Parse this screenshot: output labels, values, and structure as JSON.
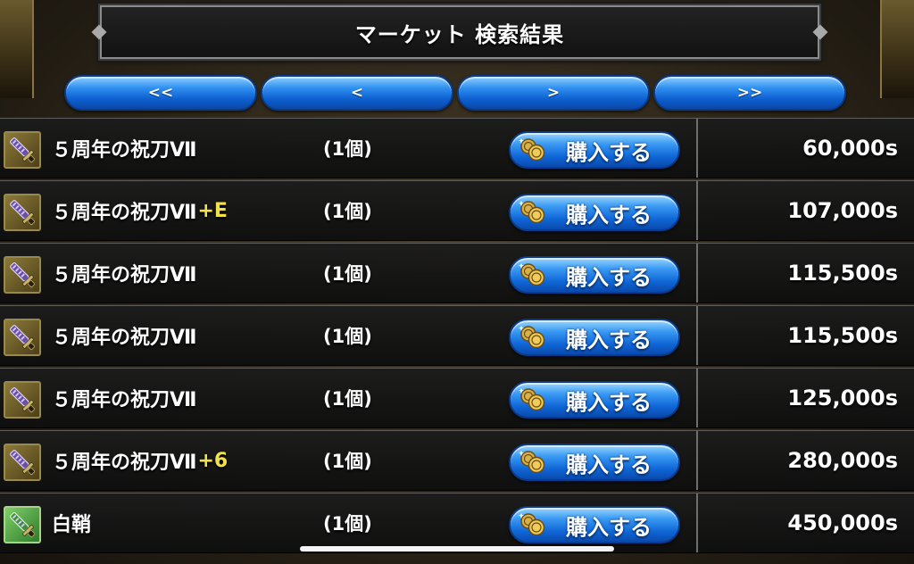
{
  "header": {
    "title": "マーケット 検索結果"
  },
  "nav": {
    "first": "<<",
    "prev": "<",
    "next": ">",
    "last": ">>"
  },
  "buy_label": "購入する",
  "colors": {
    "button_blue": "#0f66d6",
    "suffix_yellow": "#f2e24a",
    "text_white": "#ffffff"
  },
  "listings": [
    {
      "name": "５周年の祝刀Ⅶ",
      "suffix": "",
      "quantity": "(1個)",
      "price": "60,000s",
      "icon": "purple-sword-icon"
    },
    {
      "name": "５周年の祝刀Ⅶ",
      "suffix": "+E",
      "quantity": "(1個)",
      "price": "107,000s",
      "icon": "purple-sword-icon"
    },
    {
      "name": "５周年の祝刀Ⅶ",
      "suffix": "",
      "quantity": "(1個)",
      "price": "115,500s",
      "icon": "purple-sword-icon"
    },
    {
      "name": "５周年の祝刀Ⅶ",
      "suffix": "",
      "quantity": "(1個)",
      "price": "115,500s",
      "icon": "purple-sword-icon"
    },
    {
      "name": "５周年の祝刀Ⅶ",
      "suffix": "",
      "quantity": "(1個)",
      "price": "125,000s",
      "icon": "purple-sword-icon"
    },
    {
      "name": "５周年の祝刀Ⅶ",
      "suffix": "+6",
      "quantity": "(1個)",
      "price": "280,000s",
      "icon": "purple-sword-icon"
    },
    {
      "name": "白鞘",
      "suffix": "",
      "quantity": "(1個)",
      "price": "450,000s",
      "icon": "green-sword-icon"
    }
  ]
}
